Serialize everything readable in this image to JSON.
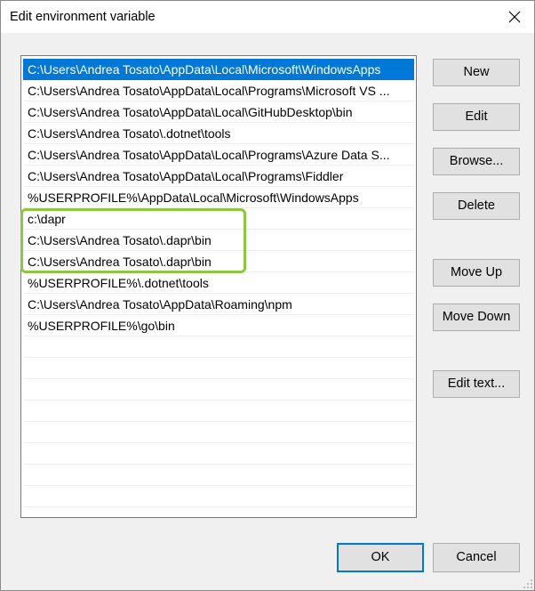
{
  "window": {
    "title": "Edit environment variable",
    "close_icon": "close-icon"
  },
  "path_list": {
    "selected_index": 0,
    "items": [
      "C:\\Users\\Andrea Tosato\\AppData\\Local\\Microsoft\\WindowsApps",
      "C:\\Users\\Andrea Tosato\\AppData\\Local\\Programs\\Microsoft VS ...",
      "C:\\Users\\Andrea Tosato\\AppData\\Local\\GitHubDesktop\\bin",
      "C:\\Users\\Andrea Tosato\\.dotnet\\tools",
      "C:\\Users\\Andrea Tosato\\AppData\\Local\\Programs\\Azure Data S...",
      "C:\\Users\\Andrea Tosato\\AppData\\Local\\Programs\\Fiddler",
      "%USERPROFILE%\\AppData\\Local\\Microsoft\\WindowsApps",
      "c:\\dapr",
      "C:\\Users\\Andrea Tosato\\.dapr\\bin",
      "C:\\Users\\Andrea Tosato\\.dapr\\bin",
      "%USERPROFILE%\\.dotnet\\tools",
      "C:\\Users\\Andrea Tosato\\AppData\\Roaming\\npm",
      "%USERPROFILE%\\go\\bin",
      "",
      "",
      "",
      "",
      "",
      "",
      "",
      "",
      "",
      ""
    ],
    "highlight_color": "#8dc63f",
    "selection_color": "#0078d7"
  },
  "buttons": {
    "new": "New",
    "edit": "Edit",
    "browse": "Browse...",
    "delete": "Delete",
    "move_up": "Move Up",
    "move_down": "Move Down",
    "edit_text": "Edit text...",
    "ok": "OK",
    "cancel": "Cancel"
  }
}
